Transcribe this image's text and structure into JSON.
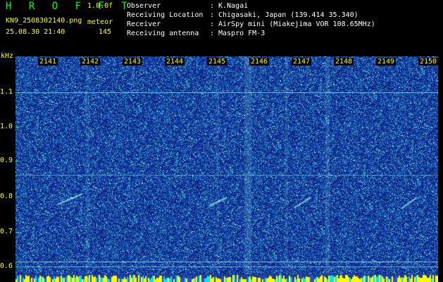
{
  "header": {
    "app_title": "H R O F F T",
    "version": "1.0.0f",
    "filename": "KN9_2508302140.png",
    "mode": "meteor",
    "datetime": "25.08.30 21:40",
    "count": "145",
    "info": [
      {
        "key": "Observer",
        "value": "K.Nagai"
      },
      {
        "key": "Receiving Location",
        "value": "Chigasaki, Japan (139.414 35.340)"
      },
      {
        "key": "Receiver",
        "value": "AirSpy mini (Miakejima VOR 108.65MHz)"
      },
      {
        "key": "Receiving antenna",
        "value": "Maspro FM-3"
      }
    ]
  },
  "axis": {
    "unit": "kHz",
    "time_labels": [
      "2141",
      "2142",
      "2143",
      "2144",
      "2145",
      "2146",
      "2147",
      "2148",
      "2149",
      "2150"
    ],
    "freq_labels": [
      "1.1",
      "1.0",
      "0.9",
      "0.8",
      "0.7",
      "0.6"
    ]
  },
  "colors": {
    "background": "#000000",
    "plot_base": "#123898",
    "label_yellow": "#ffff00",
    "label_green": "#00ff00",
    "info_white": "#ffffff",
    "carrier_line": "#5fd4e4"
  }
}
